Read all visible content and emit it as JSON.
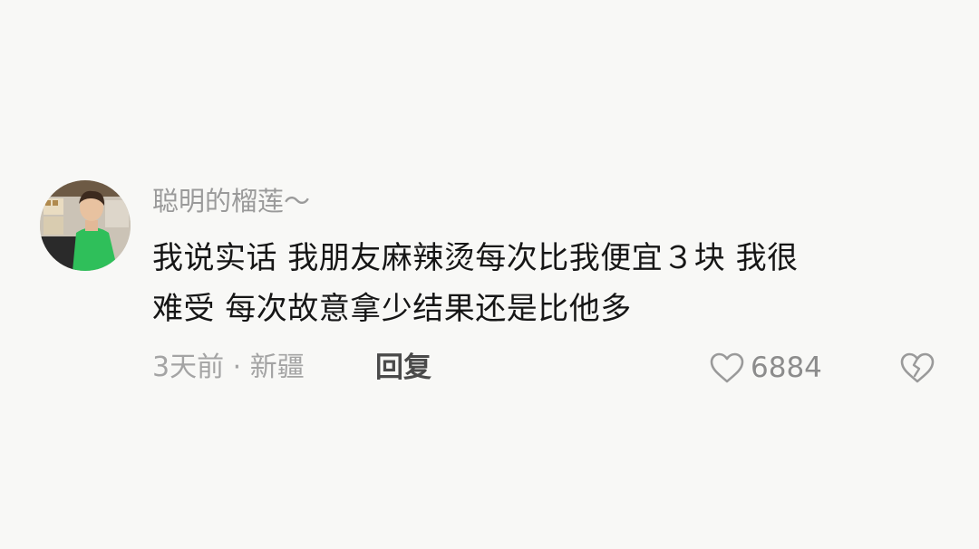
{
  "comment": {
    "username": "聪明的榴莲～",
    "text_lines": [
      "我说实话 我朋友麻辣烫每次比我便宜３块 我很",
      "难受 每次故意拿少结果还是比他多"
    ],
    "time": "3天前",
    "separator": "·",
    "location": "新疆",
    "reply_label": "回复",
    "like_count": "6884",
    "like_icon": "heart-outline-icon",
    "dislike_icon": "broken-heart-icon"
  },
  "colors": {
    "background": "#f8f8f6",
    "text": "#161616",
    "muted": "#a4a4a4",
    "avatar_shirt": "#2fbf5a"
  }
}
